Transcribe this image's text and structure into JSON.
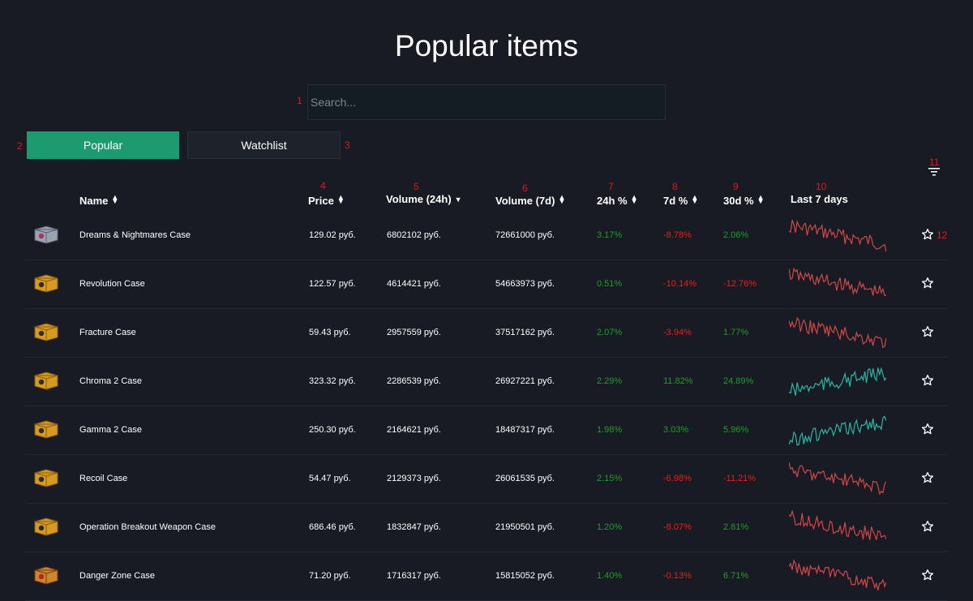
{
  "page": {
    "title": "Popular items",
    "search_placeholder": "Search...",
    "search_value": ""
  },
  "tabs": [
    {
      "label": "Popular",
      "active": true
    },
    {
      "label": "Watchlist",
      "active": false
    }
  ],
  "annotations": [
    "1",
    "2",
    "3",
    "4",
    "5",
    "6",
    "7",
    "8",
    "9",
    "10",
    "11",
    "12"
  ],
  "columns": {
    "name": "Name",
    "price": "Price",
    "vol24": "Volume (24h)",
    "vol7": "Volume (7d)",
    "p24": "24h %",
    "p7": "7d %",
    "p30": "30d %",
    "last7": "Last 7 days"
  },
  "colors": {
    "background": "#181b23",
    "accent": "#1d9a70",
    "positive": "#1e9d28",
    "negative": "#ee1c1c",
    "spark_up": "#2bb5a5",
    "spark_down": "#d04848",
    "annotation": "#e01818"
  },
  "icons": {
    "filter": "filter-icon",
    "star": "star-icon",
    "sort": "sort-icon",
    "sort_active": "sort-desc-icon",
    "case": "case-icon"
  },
  "rows": [
    {
      "name": "Dreams & Nightmares Case",
      "price": "129.02 руб.",
      "vol24": "6802102 руб.",
      "vol7": "72661000 руб.",
      "p24": "3.17%",
      "p7": "-8.78%",
      "p30": "2.06%",
      "trend": "down",
      "case": "dreams"
    },
    {
      "name": "Revolution Case",
      "price": "122.57 руб.",
      "vol24": "4614421 руб.",
      "vol7": "54663973 руб.",
      "p24": "0.51%",
      "p7": "-10.14%",
      "p30": "-12.76%",
      "trend": "down",
      "case": "gold"
    },
    {
      "name": "Fracture Case",
      "price": "59.43 руб.",
      "vol24": "2957559 руб.",
      "vol7": "37517162 руб.",
      "p24": "2.07%",
      "p7": "-3.94%",
      "p30": "1.77%",
      "trend": "down",
      "case": "gold"
    },
    {
      "name": "Chroma 2 Case",
      "price": "323.32 руб.",
      "vol24": "2286539 руб.",
      "vol7": "26927221 руб.",
      "p24": "2.29%",
      "p7": "11.82%",
      "p30": "24.89%",
      "trend": "up",
      "case": "gold"
    },
    {
      "name": "Gamma 2 Case",
      "price": "250.30 руб.",
      "vol24": "2164621 руб.",
      "vol7": "18487317 руб.",
      "p24": "1.98%",
      "p7": "3.03%",
      "p30": "5.96%",
      "trend": "up",
      "case": "gold"
    },
    {
      "name": "Recoil Case",
      "price": "54.47 руб.",
      "vol24": "2129373 руб.",
      "vol7": "26061535 руб.",
      "p24": "2.15%",
      "p7": "-6.98%",
      "p30": "-11.21%",
      "trend": "down",
      "case": "gold"
    },
    {
      "name": "Operation Breakout Weapon Case",
      "price": "686.46 руб.",
      "vol24": "1832847 руб.",
      "vol7": "21950501 руб.",
      "p24": "1.20%",
      "p7": "-8.07%",
      "p30": "2.81%",
      "trend": "down",
      "case": "gold"
    },
    {
      "name": "Danger Zone Case",
      "price": "71.20 руб.",
      "vol24": "1716317 руб.",
      "vol7": "15815052 руб.",
      "p24": "1.40%",
      "p7": "-0.13%",
      "p30": "6.71%",
      "trend": "down",
      "case": "danger"
    }
  ]
}
